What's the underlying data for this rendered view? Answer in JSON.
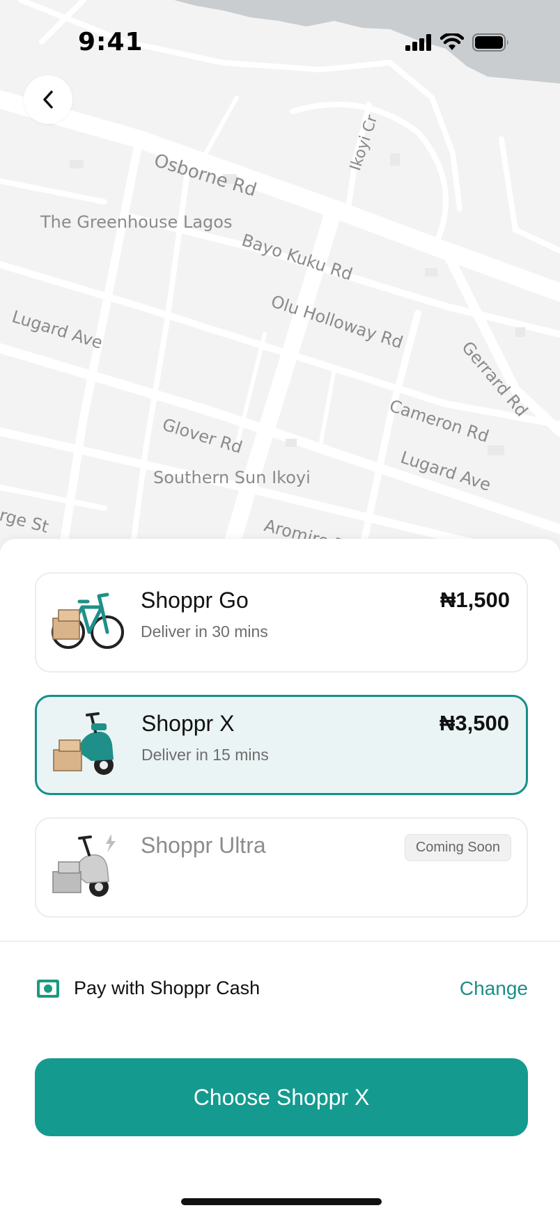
{
  "status_bar": {
    "time": "9:41"
  },
  "map": {
    "labels": {
      "osborne": "Osborne Rd",
      "ikoyi_cr": "Ikoyi Cr",
      "greenhouse": "The Greenhouse Lagos",
      "bayo_kuku": "Bayo Kuku Rd",
      "olu_holloway": "Olu Holloway Rd",
      "lugard_1": "Lugard Ave",
      "gerrard": "Gerrard Rd",
      "cameron": "Cameron Rd",
      "glover": "Glover Rd",
      "lugard_2": "Lugard Ave",
      "southern_sun": "Southern Sun Ikoyi",
      "aromire": "Aromire Rd",
      "george": "rge St"
    },
    "colors": {
      "land": "#f3f3f3",
      "roads": "#ffffff",
      "water": "#c9cdd0"
    }
  },
  "options": [
    {
      "name": "Shoppr Go",
      "subtitle": "Deliver in 30 mins",
      "price": "₦1,500",
      "icon": "bicycle-icon",
      "selected": false
    },
    {
      "name": "Shoppr X",
      "subtitle": "Deliver in 15 mins",
      "price": "₦3,500",
      "icon": "scooter-icon",
      "selected": true
    },
    {
      "name": "Shoppr Ultra",
      "subtitle": "",
      "badge": "Coming Soon",
      "icon": "electric-scooter-icon",
      "selected": false
    }
  ],
  "payment": {
    "label": "Pay with Shoppr Cash",
    "change_label": "Change",
    "icon": "cash-icon"
  },
  "cta": {
    "label": "Choose Shoppr X"
  },
  "colors": {
    "accent": "#149a8f",
    "selected_bg": "#eaf4f4",
    "selected_border": "#158f88"
  }
}
